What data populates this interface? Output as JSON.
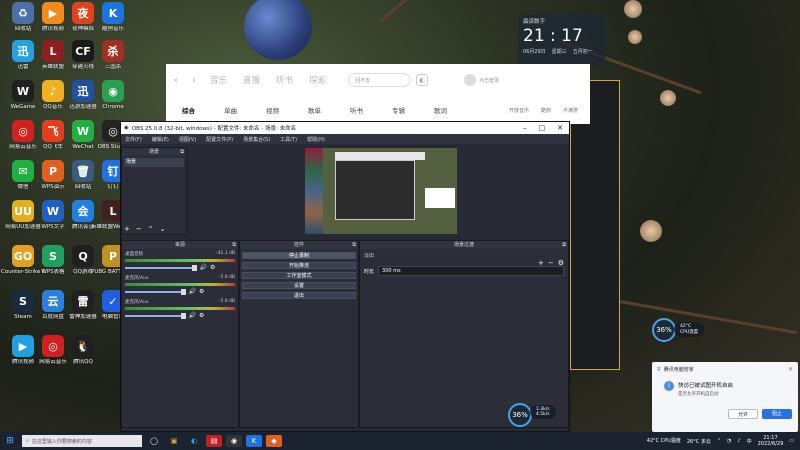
{
  "desktop": {
    "icons": [
      {
        "label": "回收站",
        "color": "#4b6fa8",
        "glyph": "♻"
      },
      {
        "label": "腾讯视频",
        "color": "#f28a1c",
        "glyph": "▶"
      },
      {
        "label": "夜神模拟",
        "color": "#e0421c",
        "glyph": "夜"
      },
      {
        "label": "酷狗音乐",
        "color": "#1d74e0",
        "glyph": "K"
      },
      {
        "label": "迅雷",
        "color": "#2a9fe0",
        "glyph": "迅"
      },
      {
        "label": "英雄联盟",
        "color": "#8a2020",
        "glyph": "L"
      },
      {
        "label": "穿越火线",
        "color": "#1a1a1a",
        "glyph": "CF"
      },
      {
        "label": "三国杀",
        "color": "#a03020",
        "glyph": "杀"
      },
      {
        "label": "WeGame",
        "color": "#202020",
        "glyph": "W"
      },
      {
        "label": "QQ音乐",
        "color": "#f0b020",
        "glyph": "♪"
      },
      {
        "label": "迅游加速器",
        "color": "#2050a0",
        "glyph": "迅"
      },
      {
        "label": "Chrome",
        "color": "#2aa050",
        "glyph": "◉"
      },
      {
        "label": "网易云音乐",
        "color": "#d02020",
        "glyph": "◎"
      },
      {
        "label": "QQ飞车",
        "color": "#e04020",
        "glyph": "飞"
      },
      {
        "label": "WeChat",
        "color": "#20b040",
        "glyph": "W"
      },
      {
        "label": "OBS Studio",
        "color": "#222",
        "glyph": "◎"
      },
      {
        "label": "微信",
        "color": "#20b040",
        "glyph": "✉"
      },
      {
        "label": "WPS演示",
        "color": "#e06020",
        "glyph": "P"
      },
      {
        "label": "回收站",
        "color": "#3a5a80",
        "glyph": "🗑"
      },
      {
        "label": "钉钉",
        "color": "#2070e0",
        "glyph": "钉"
      },
      {
        "label": "网易UU加速器",
        "color": "#e0b020",
        "glyph": "UU"
      },
      {
        "label": "WPS文字",
        "color": "#2060c0",
        "glyph": "W"
      },
      {
        "label": "腾讯会议",
        "color": "#2080e0",
        "glyph": "会"
      },
      {
        "label": "英雄联盟WeGame",
        "color": "#402020",
        "glyph": "L"
      },
      {
        "label": "Counter-Strike Global...",
        "color": "#e0a020",
        "glyph": "GO"
      },
      {
        "label": "WPS表格",
        "color": "#20a060",
        "glyph": "S"
      },
      {
        "label": "QQ游戏",
        "color": "#202020",
        "glyph": "Q"
      },
      {
        "label": "PUBG BATTLEGR...",
        "color": "#c09020",
        "glyph": "P"
      },
      {
        "label": "Steam",
        "color": "#1a2a40",
        "glyph": "S"
      },
      {
        "label": "百度网盘",
        "color": "#2a80e0",
        "glyph": "云"
      },
      {
        "label": "雷神加速器",
        "color": "#202020",
        "glyph": "雷"
      },
      {
        "label": "电脑管家",
        "color": "#2060e0",
        "glyph": "✓"
      },
      {
        "label": "腾讯视频",
        "color": "#20a0e0",
        "glyph": "▶"
      },
      {
        "label": "网易云音乐",
        "color": "#d02020",
        "glyph": "◎"
      },
      {
        "label": "腾讯QQ",
        "color": "#202020",
        "glyph": "🐧"
      }
    ]
  },
  "clock_widget": {
    "header": "晨读数字",
    "time": "21 : 17",
    "date": "06月29日",
    "weekday": "星期三",
    "lunar": "五月初一"
  },
  "music_app": {
    "nav_tabs": [
      "音乐",
      "直播",
      "听书",
      "探索"
    ],
    "search_placeholder": "回不去",
    "login": "点击登录",
    "sub_tabs": [
      "综合",
      "单曲",
      "视频",
      "歌单",
      "听书",
      "专辑",
      "歌词"
    ],
    "right_links": [
      "开放音乐",
      "酷狗",
      "不满意"
    ]
  },
  "obs": {
    "title": "OBS 25.0.8 (32-bit, windows) - 配置文件: 未命名 - 场景: 未命名",
    "menus": [
      "文件(F)",
      "编辑(E)",
      "视图(V)",
      "配置文件(P)",
      "场景集合(S)",
      "工具(T)",
      "帮助(H)"
    ],
    "docks": {
      "scenes": "场景",
      "sources": "来源",
      "mixer": "音频混音器",
      "transitions": "场景过渡",
      "controls": "控件"
    },
    "scene_item": "场景",
    "controls": [
      "停止录制",
      "开始推流",
      "工作室模式",
      "设置",
      "退出"
    ],
    "transition_label": "淡出",
    "duration_label": "时长",
    "duration_value": "300 ms",
    "mixer_channels": [
      {
        "name": "桌面音频",
        "db": "-41.1 dB",
        "level": 0.65
      },
      {
        "name": "麦克风/Aux",
        "db": "-5.0 dB",
        "level": 0.55
      },
      {
        "name": "麦克风/Aux",
        "db": "-5.0 dB",
        "level": 0.55
      }
    ]
  },
  "taskbar": {
    "search_placeholder": "在这里输入你要搜索的内容",
    "weather": "26°C 多云",
    "cpu": "42°C CPU温度",
    "time": "21:17",
    "date": "2022/6/29",
    "lang": "中"
  },
  "gauges": {
    "main": "36%",
    "cpu": "42°C",
    "cpu_label": "CPU温度",
    "net_up": "1.3k/s",
    "net_down": "4.5k/s"
  },
  "notification": {
    "app": "腾讯电脑管家",
    "title": "快访已被试图开机自启",
    "body": "是否允许开机自启动",
    "allow": "允许",
    "block": "阻止"
  }
}
